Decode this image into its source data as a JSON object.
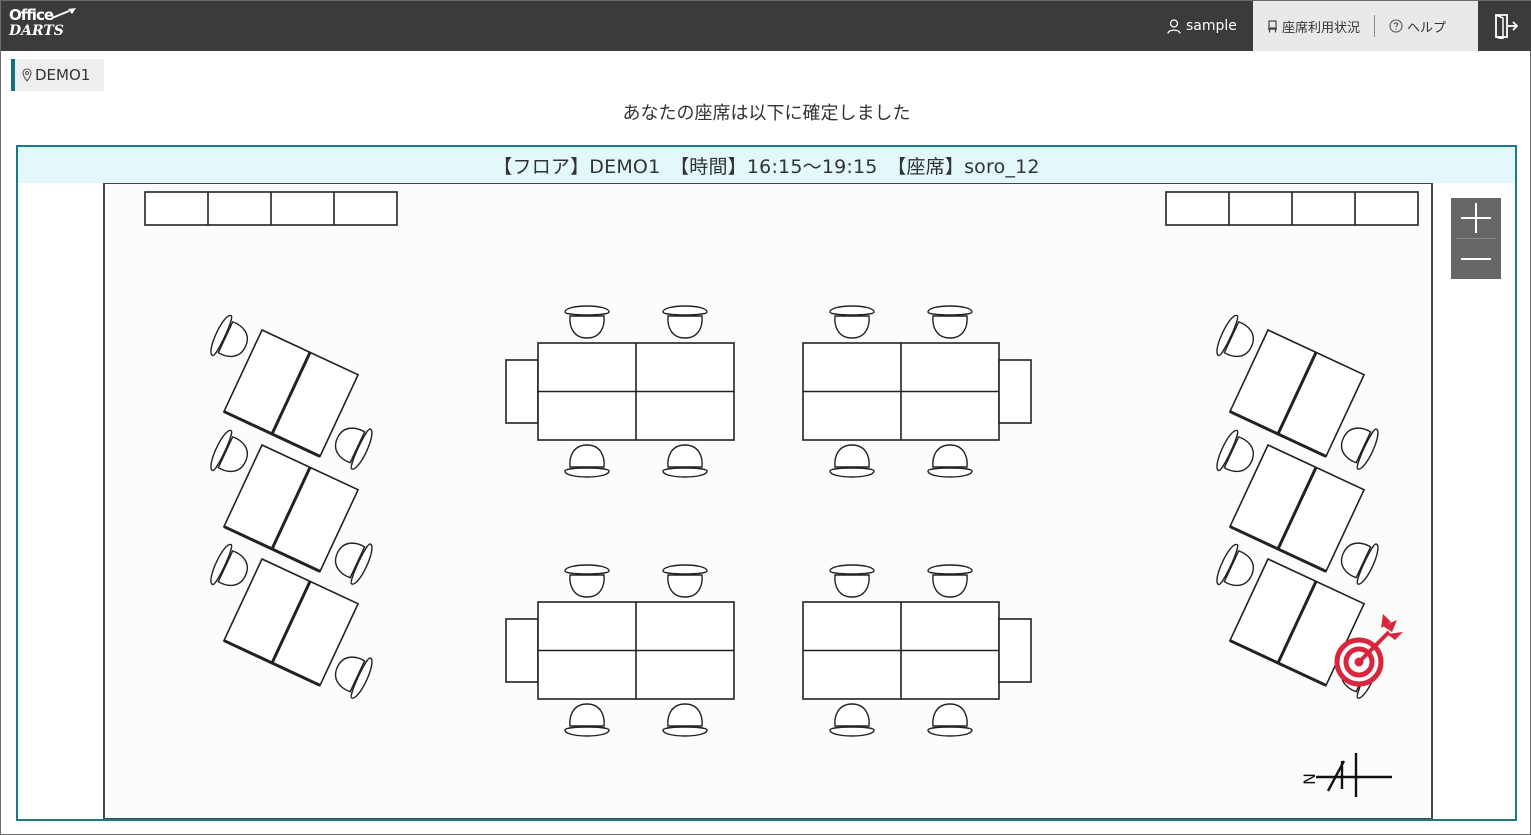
{
  "header": {
    "logo_line1": "Office",
    "logo_line2": "DARTS",
    "user_name": "sample",
    "nav_status_label": "座席利用状況",
    "nav_help_label": "ヘルプ"
  },
  "location_tag": "DEMO1",
  "confirmation_message": "あなたの座席は以下に確定しました",
  "reservation": {
    "info_text": "【フロア】DEMO1　【時間】16:15～19:15　【座席】soro_12",
    "floor": "DEMO1",
    "time": "16:15～19:15",
    "seat": "soro_12"
  },
  "map": {
    "selected_seat_color": "#d7263d",
    "background": "#fbfdfb",
    "compass_label": "N"
  },
  "icons": {
    "user": "user-icon",
    "seat_status": "chair-icon",
    "help": "help-circle-icon",
    "logout": "logout-icon",
    "location": "map-pin-icon",
    "zoom_in": "plus-icon",
    "zoom_out": "minus-icon",
    "selected": "dart-target-icon"
  }
}
